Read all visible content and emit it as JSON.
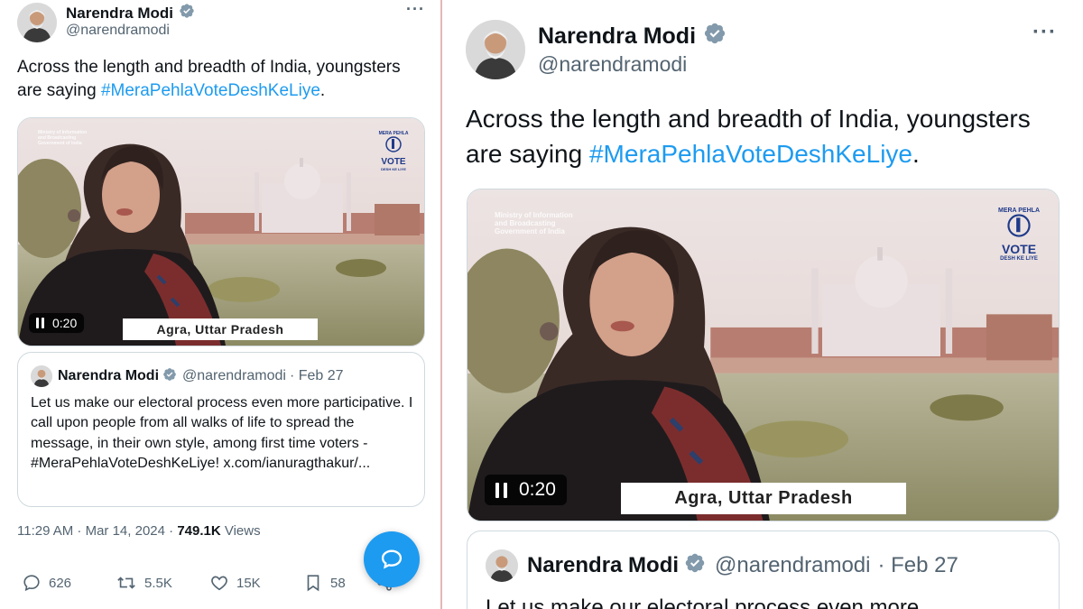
{
  "tweet": {
    "author_name": "Narendra Modi",
    "author_handle": "@narendramodi",
    "text_main": "Across the length and breadth of India, youngsters are saying ",
    "hashtag": "#MeraPehlaVoteDeshKeLiye",
    "text_end": ".",
    "video": {
      "duration": "0:20",
      "location": "Agra, Uttar Pradesh",
      "ministry_line1": "Ministry of Information",
      "ministry_line2": "and Broadcasting",
      "ministry_line3": "Government of India",
      "logo_top": "MERA PEHLA",
      "logo_main": "VOTE",
      "logo_bottom": "DESH KE LIYE"
    },
    "quoted": {
      "name": "Narendra Modi",
      "handle": "@narendramodi",
      "date": "· Feb 27",
      "text": "Let us make our electoral process even more participative. I call upon people from all walks of life to spread the message, in their own style, among first time voters - #MeraPehlaVoteDeshKeLiye! x.com/ianuragthakur/...",
      "text_right_partial": "Let us make our electoral process even more"
    },
    "timestamp": "11:29 AM · Mar 14, 2024 · ",
    "views_count": "749.1K",
    "views_label": " Views",
    "stats": {
      "replies": "626",
      "reposts": "5.5K",
      "likes": "15K",
      "bookmarks": "58"
    }
  },
  "colors": {
    "accent": "#1d9bf0",
    "verified": "#829aab",
    "text": "#0f1419",
    "secondary": "#536471"
  },
  "icons": [
    "verified-badge-icon",
    "more-icon",
    "pause-icon",
    "reply-icon",
    "repost-icon",
    "like-icon",
    "bookmark-icon",
    "share-icon",
    "chat-bubble-icon"
  ]
}
